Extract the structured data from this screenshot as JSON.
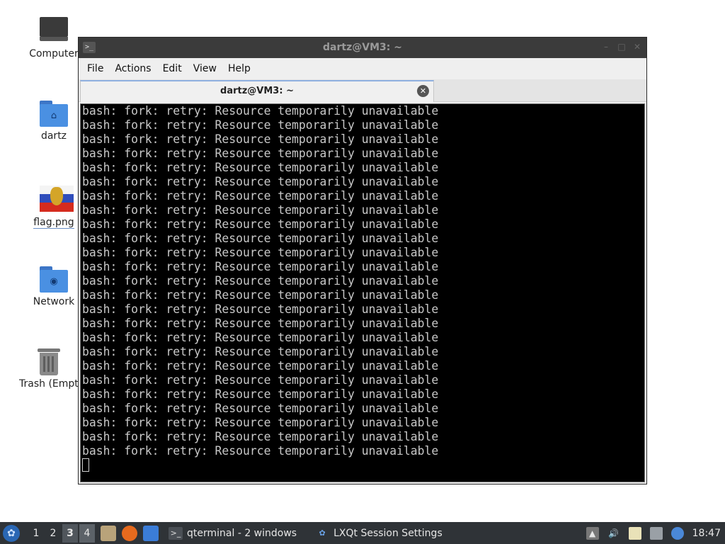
{
  "desktop": {
    "icons": [
      {
        "label": "Computer",
        "icon": "computer-icon"
      },
      {
        "label": "dartz",
        "icon": "home-folder-icon"
      },
      {
        "label": "flag.png",
        "icon": "image-file-icon"
      },
      {
        "label": "Network",
        "icon": "network-folder-icon"
      },
      {
        "label": "Trash (Empty)",
        "icon": "trash-icon"
      }
    ]
  },
  "window": {
    "title": "dartz@VM3: ~",
    "app_icon_glyph": ">_",
    "menu": [
      "File",
      "Actions",
      "Edit",
      "View",
      "Help"
    ],
    "tab": {
      "label": "dartz@VM3: ~"
    },
    "terminal": {
      "line_text": "bash: fork: retry: Resource temporarily unavailable",
      "line_count": 25
    }
  },
  "taskbar": {
    "workspaces": [
      "1",
      "2",
      "3",
      "4"
    ],
    "active_workspace": "3",
    "tasks": [
      {
        "label": "qterminal - 2 windows",
        "icon": "terminal-icon"
      },
      {
        "label": "LXQt Session Settings",
        "icon": "lxqt-settings-icon"
      }
    ],
    "clock": "18:47"
  },
  "colors": {
    "taskbar_bg": "#2f3337",
    "titlebar_bg": "#3b3b3b",
    "terminal_bg": "#000000",
    "terminal_fg": "#c8c8c8",
    "folder_blue": "#4a90e2"
  }
}
